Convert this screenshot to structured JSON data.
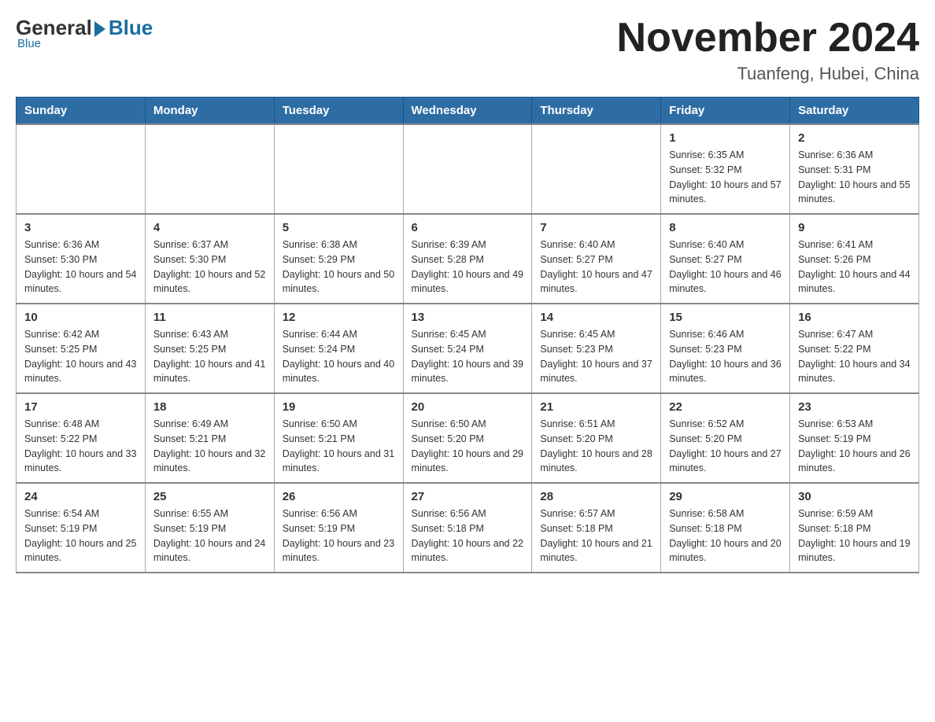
{
  "header": {
    "logo_general": "General",
    "logo_blue": "Blue",
    "month_title": "November 2024",
    "location": "Tuanfeng, Hubei, China"
  },
  "days_of_week": [
    "Sunday",
    "Monday",
    "Tuesday",
    "Wednesday",
    "Thursday",
    "Friday",
    "Saturday"
  ],
  "weeks": [
    [
      {
        "day": "",
        "sunrise": "",
        "sunset": "",
        "daylight": ""
      },
      {
        "day": "",
        "sunrise": "",
        "sunset": "",
        "daylight": ""
      },
      {
        "day": "",
        "sunrise": "",
        "sunset": "",
        "daylight": ""
      },
      {
        "day": "",
        "sunrise": "",
        "sunset": "",
        "daylight": ""
      },
      {
        "day": "",
        "sunrise": "",
        "sunset": "",
        "daylight": ""
      },
      {
        "day": "1",
        "sunrise": "Sunrise: 6:35 AM",
        "sunset": "Sunset: 5:32 PM",
        "daylight": "Daylight: 10 hours and 57 minutes."
      },
      {
        "day": "2",
        "sunrise": "Sunrise: 6:36 AM",
        "sunset": "Sunset: 5:31 PM",
        "daylight": "Daylight: 10 hours and 55 minutes."
      }
    ],
    [
      {
        "day": "3",
        "sunrise": "Sunrise: 6:36 AM",
        "sunset": "Sunset: 5:30 PM",
        "daylight": "Daylight: 10 hours and 54 minutes."
      },
      {
        "day": "4",
        "sunrise": "Sunrise: 6:37 AM",
        "sunset": "Sunset: 5:30 PM",
        "daylight": "Daylight: 10 hours and 52 minutes."
      },
      {
        "day": "5",
        "sunrise": "Sunrise: 6:38 AM",
        "sunset": "Sunset: 5:29 PM",
        "daylight": "Daylight: 10 hours and 50 minutes."
      },
      {
        "day": "6",
        "sunrise": "Sunrise: 6:39 AM",
        "sunset": "Sunset: 5:28 PM",
        "daylight": "Daylight: 10 hours and 49 minutes."
      },
      {
        "day": "7",
        "sunrise": "Sunrise: 6:40 AM",
        "sunset": "Sunset: 5:27 PM",
        "daylight": "Daylight: 10 hours and 47 minutes."
      },
      {
        "day": "8",
        "sunrise": "Sunrise: 6:40 AM",
        "sunset": "Sunset: 5:27 PM",
        "daylight": "Daylight: 10 hours and 46 minutes."
      },
      {
        "day": "9",
        "sunrise": "Sunrise: 6:41 AM",
        "sunset": "Sunset: 5:26 PM",
        "daylight": "Daylight: 10 hours and 44 minutes."
      }
    ],
    [
      {
        "day": "10",
        "sunrise": "Sunrise: 6:42 AM",
        "sunset": "Sunset: 5:25 PM",
        "daylight": "Daylight: 10 hours and 43 minutes."
      },
      {
        "day": "11",
        "sunrise": "Sunrise: 6:43 AM",
        "sunset": "Sunset: 5:25 PM",
        "daylight": "Daylight: 10 hours and 41 minutes."
      },
      {
        "day": "12",
        "sunrise": "Sunrise: 6:44 AM",
        "sunset": "Sunset: 5:24 PM",
        "daylight": "Daylight: 10 hours and 40 minutes."
      },
      {
        "day": "13",
        "sunrise": "Sunrise: 6:45 AM",
        "sunset": "Sunset: 5:24 PM",
        "daylight": "Daylight: 10 hours and 39 minutes."
      },
      {
        "day": "14",
        "sunrise": "Sunrise: 6:45 AM",
        "sunset": "Sunset: 5:23 PM",
        "daylight": "Daylight: 10 hours and 37 minutes."
      },
      {
        "day": "15",
        "sunrise": "Sunrise: 6:46 AM",
        "sunset": "Sunset: 5:23 PM",
        "daylight": "Daylight: 10 hours and 36 minutes."
      },
      {
        "day": "16",
        "sunrise": "Sunrise: 6:47 AM",
        "sunset": "Sunset: 5:22 PM",
        "daylight": "Daylight: 10 hours and 34 minutes."
      }
    ],
    [
      {
        "day": "17",
        "sunrise": "Sunrise: 6:48 AM",
        "sunset": "Sunset: 5:22 PM",
        "daylight": "Daylight: 10 hours and 33 minutes."
      },
      {
        "day": "18",
        "sunrise": "Sunrise: 6:49 AM",
        "sunset": "Sunset: 5:21 PM",
        "daylight": "Daylight: 10 hours and 32 minutes."
      },
      {
        "day": "19",
        "sunrise": "Sunrise: 6:50 AM",
        "sunset": "Sunset: 5:21 PM",
        "daylight": "Daylight: 10 hours and 31 minutes."
      },
      {
        "day": "20",
        "sunrise": "Sunrise: 6:50 AM",
        "sunset": "Sunset: 5:20 PM",
        "daylight": "Daylight: 10 hours and 29 minutes."
      },
      {
        "day": "21",
        "sunrise": "Sunrise: 6:51 AM",
        "sunset": "Sunset: 5:20 PM",
        "daylight": "Daylight: 10 hours and 28 minutes."
      },
      {
        "day": "22",
        "sunrise": "Sunrise: 6:52 AM",
        "sunset": "Sunset: 5:20 PM",
        "daylight": "Daylight: 10 hours and 27 minutes."
      },
      {
        "day": "23",
        "sunrise": "Sunrise: 6:53 AM",
        "sunset": "Sunset: 5:19 PM",
        "daylight": "Daylight: 10 hours and 26 minutes."
      }
    ],
    [
      {
        "day": "24",
        "sunrise": "Sunrise: 6:54 AM",
        "sunset": "Sunset: 5:19 PM",
        "daylight": "Daylight: 10 hours and 25 minutes."
      },
      {
        "day": "25",
        "sunrise": "Sunrise: 6:55 AM",
        "sunset": "Sunset: 5:19 PM",
        "daylight": "Daylight: 10 hours and 24 minutes."
      },
      {
        "day": "26",
        "sunrise": "Sunrise: 6:56 AM",
        "sunset": "Sunset: 5:19 PM",
        "daylight": "Daylight: 10 hours and 23 minutes."
      },
      {
        "day": "27",
        "sunrise": "Sunrise: 6:56 AM",
        "sunset": "Sunset: 5:18 PM",
        "daylight": "Daylight: 10 hours and 22 minutes."
      },
      {
        "day": "28",
        "sunrise": "Sunrise: 6:57 AM",
        "sunset": "Sunset: 5:18 PM",
        "daylight": "Daylight: 10 hours and 21 minutes."
      },
      {
        "day": "29",
        "sunrise": "Sunrise: 6:58 AM",
        "sunset": "Sunset: 5:18 PM",
        "daylight": "Daylight: 10 hours and 20 minutes."
      },
      {
        "day": "30",
        "sunrise": "Sunrise: 6:59 AM",
        "sunset": "Sunset: 5:18 PM",
        "daylight": "Daylight: 10 hours and 19 minutes."
      }
    ]
  ]
}
